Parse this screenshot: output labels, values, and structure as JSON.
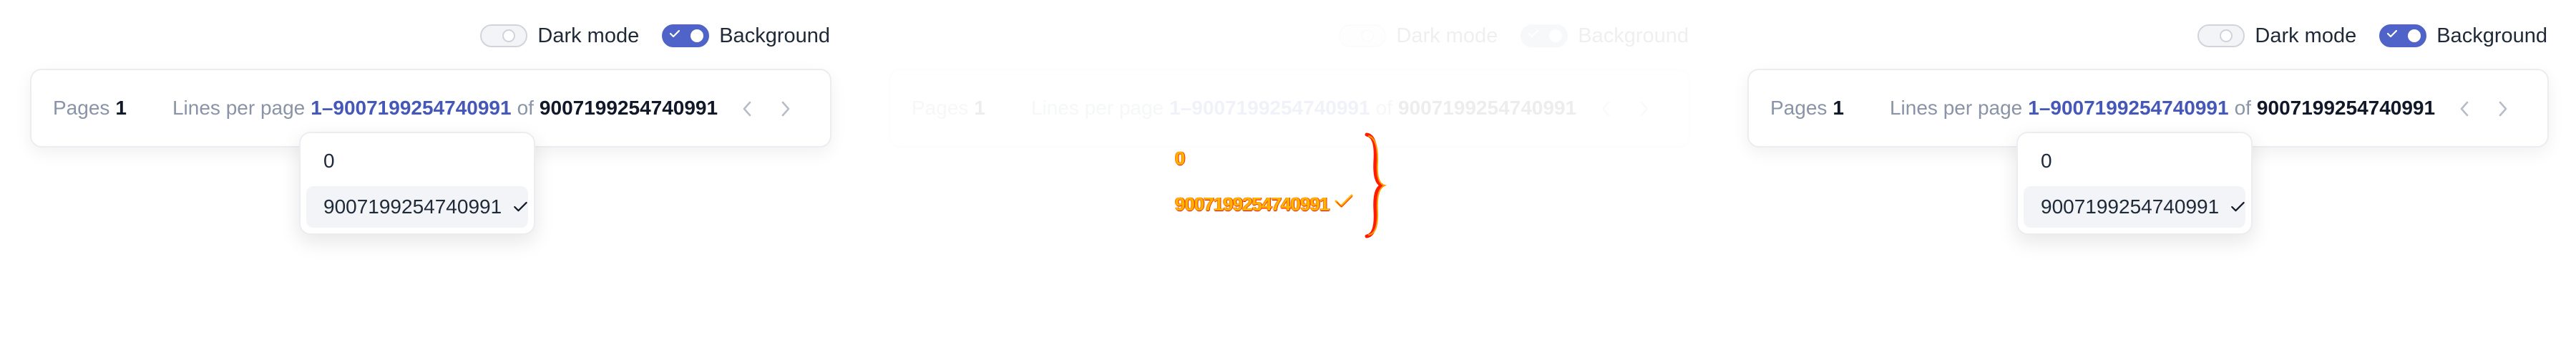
{
  "controls": {
    "dark_mode_label": "Dark mode",
    "background_label": "Background",
    "dark_mode_on": false,
    "background_on": true
  },
  "pager": {
    "pages_label": "Pages",
    "pages_value": "1",
    "lines_per_page_label": "Lines per page",
    "range": "1–9007199254740991",
    "of_label": "of",
    "total": "9007199254740991"
  },
  "dropdown": {
    "options": [
      "0",
      "9007199254740991"
    ],
    "selected": "9007199254740991"
  },
  "colors": {
    "accent": "#4f63c9",
    "range_text": "#4558b8",
    "glitch": "#ffb400"
  },
  "icons": {
    "prev": "chevron-left-icon",
    "next": "chevron-right-icon",
    "selected": "check-icon"
  }
}
